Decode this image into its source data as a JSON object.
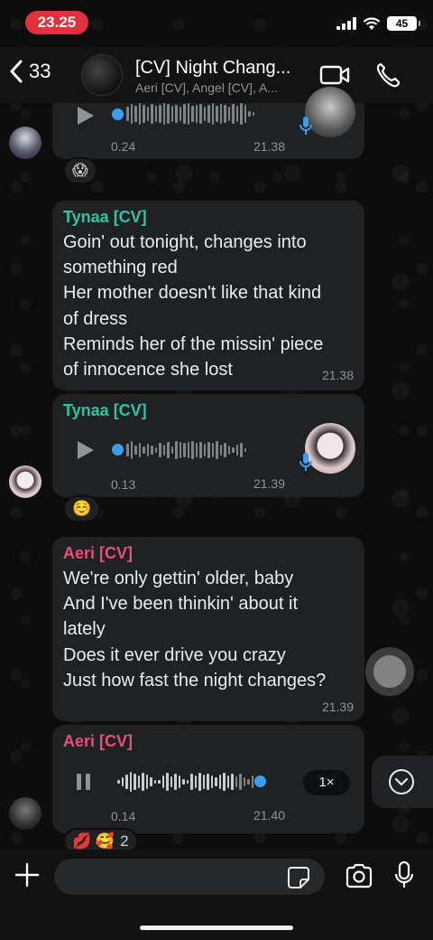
{
  "status": {
    "time": "23.25",
    "battery": "45"
  },
  "header": {
    "back_count": "33",
    "title": "[CV] Night Chang...",
    "subtitle": "Aeri [CV], Angel [CV], A..."
  },
  "messages": [
    {
      "type": "voice",
      "duration": "0.24",
      "time": "21.38",
      "reaction": "😱"
    },
    {
      "type": "text",
      "sender": "Tynaa [CV]",
      "sender_color": "#2ec4a0",
      "time": "21.38",
      "lines": [
        "Goin' out tonight, changes into",
        "something red",
        "Her mother doesn't like that kind",
        "of dress",
        "Reminds her of the missin' piece",
        "of innocence she lost"
      ]
    },
    {
      "type": "voice",
      "sender": "Tynaa [CV]",
      "sender_color": "#2ec4a0",
      "duration": "0.13",
      "time": "21.39",
      "reaction": "☺️"
    },
    {
      "type": "text",
      "sender": "Aeri [CV]",
      "sender_color": "#e8507a",
      "time": "21.39",
      "lines": [
        "We're only gettin' older, baby",
        "And I've been thinkin' about it",
        "lately",
        "Does it ever drive you crazy",
        "Just how fast the night changes?"
      ]
    },
    {
      "type": "voice",
      "sender": "Aeri [CV]",
      "sender_color": "#e8507a",
      "duration": "0.14",
      "time": "21.40",
      "speed": "1×",
      "reaction": "💋 🥰",
      "reaction_count": "2"
    }
  ],
  "composer": {
    "placeholder": ""
  },
  "colors": {
    "accent_blue": "#3b9cf0",
    "bubble": "#1f2123",
    "status_red": "#e0313c"
  }
}
